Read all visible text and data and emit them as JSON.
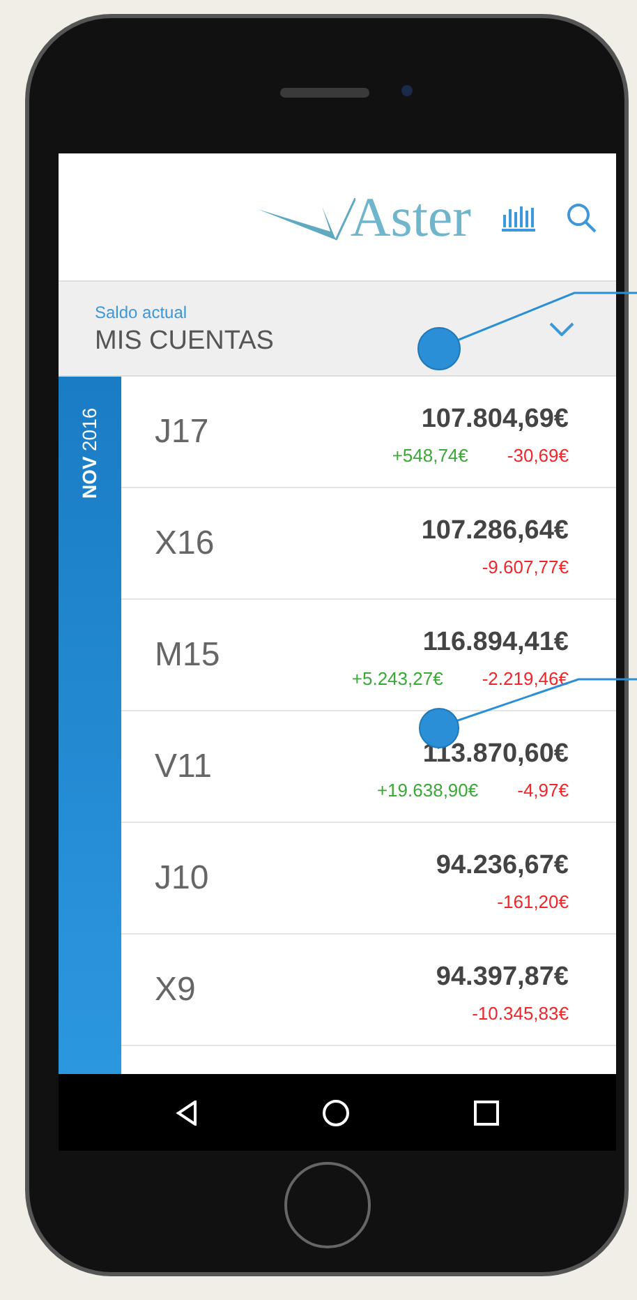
{
  "header": {
    "logo": "Aster"
  },
  "account": {
    "label": "Saldo actual",
    "name": "MIS CUENTAS"
  },
  "period": {
    "month": "NOV",
    "year": "2016"
  },
  "days": [
    {
      "day": "J17",
      "balance": "107.804,69€",
      "income": "+548,74€",
      "expense": "-30,69€"
    },
    {
      "day": "X16",
      "balance": "107.286,64€",
      "expense": "-9.607,77€"
    },
    {
      "day": "M15",
      "balance": "116.894,41€",
      "income": "+5.243,27€",
      "expense": "-2.219,46€"
    },
    {
      "day": "V11",
      "balance": "113.870,60€",
      "income": "+19.638,90€",
      "expense": "-4,97€"
    },
    {
      "day": "J10",
      "balance": "94.236,67€",
      "expense": "-161,20€"
    },
    {
      "day": "X9",
      "balance": "94.397,87€",
      "expense": "-10.345,83€"
    }
  ]
}
